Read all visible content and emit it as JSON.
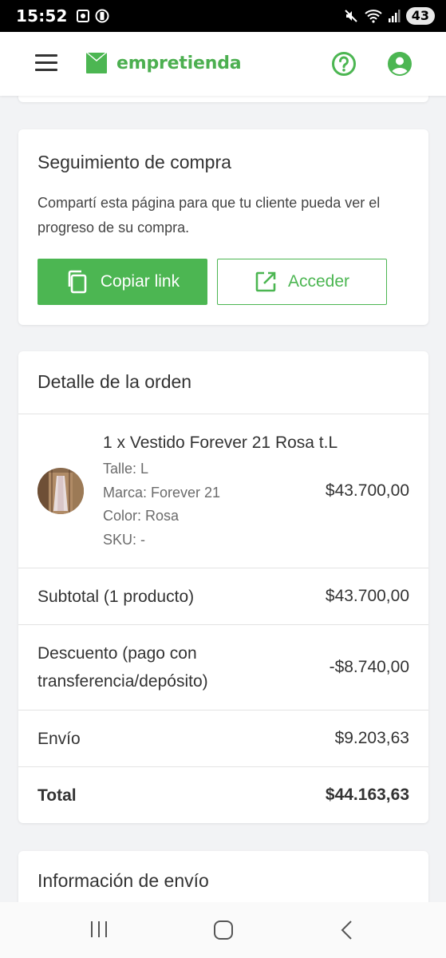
{
  "status_bar": {
    "time": "15:52",
    "battery": "43"
  },
  "app_bar": {
    "brand": "empretienda"
  },
  "tracking": {
    "title": "Seguimiento de compra",
    "description": "Compartí esta página para que tu cliente pueda ver el progreso de su compra.",
    "copy_label": "Copiar link",
    "access_label": "Acceder"
  },
  "order": {
    "title": "Detalle de la orden",
    "product": {
      "name": "1 x Vestido Forever 21 Rosa t.L",
      "attributes": [
        "Talle: L",
        "Marca: Forever 21",
        "Color: Rosa",
        "SKU: -"
      ],
      "price": "$43.700,00"
    },
    "subtotal": {
      "label": "Subtotal (1 producto)",
      "value": "$43.700,00"
    },
    "discount": {
      "label": "Descuento (pago con transferencia/depósito)",
      "value": "-$8.740,00"
    },
    "shipping": {
      "label": "Envío",
      "value": "$9.203,63"
    },
    "total": {
      "label": "Total",
      "value": "$44.163,63"
    }
  },
  "shipping_info": {
    "title": "Información de envío"
  },
  "colors": {
    "brand_green": "#4cb652",
    "text": "#333333"
  }
}
